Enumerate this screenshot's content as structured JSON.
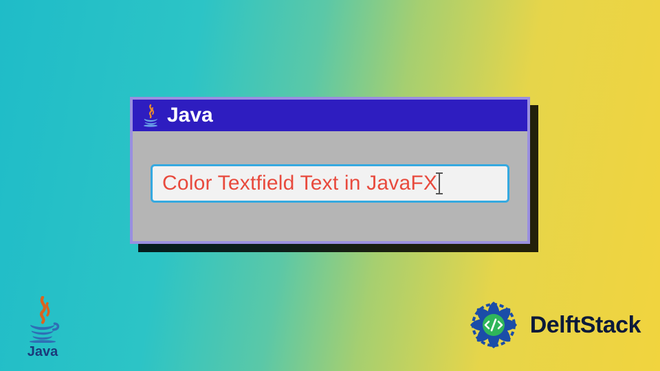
{
  "window": {
    "title": "Java",
    "titlebar_icon": "java-icon"
  },
  "textfield": {
    "value": "Color Textfield Text in JavaFX",
    "text_color": "#e84a3d",
    "border_color": "#35a9e0"
  },
  "branding": {
    "java_corner": {
      "icon": "java-icon",
      "label": "Java"
    },
    "delftstack": {
      "icon": "delftstack-badge-icon",
      "label": "DelftStack"
    }
  },
  "colors": {
    "titlebar_bg": "#2e1dc0",
    "window_border": "#9a8fe0",
    "window_body": "#b5b5b5"
  }
}
